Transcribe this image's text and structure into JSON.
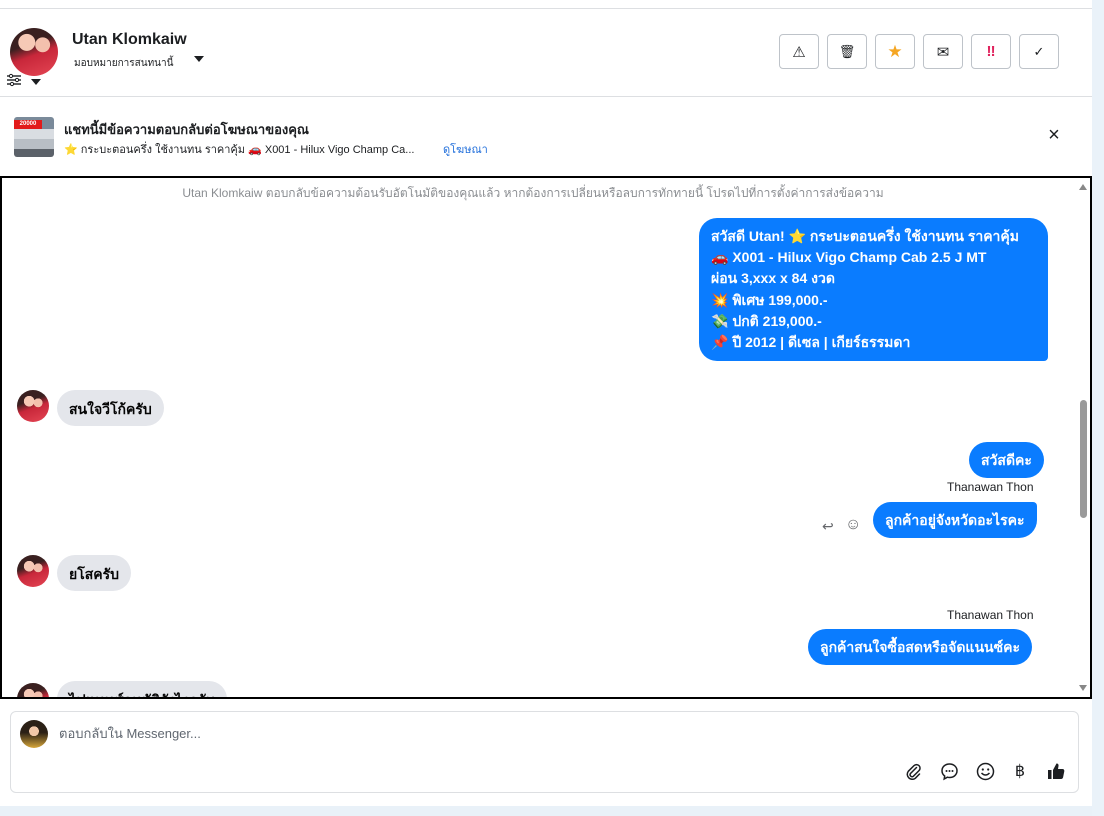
{
  "header": {
    "user_name": "Utan Klomkaiw",
    "assign_label": "มอบหมายการสนทนานี้",
    "actions": [
      {
        "name": "spam-button",
        "glyph": "⚠"
      },
      {
        "name": "delete-button",
        "glyph": "🗑"
      },
      {
        "name": "star-button",
        "glyph": "★"
      },
      {
        "name": "mark-unread-button",
        "glyph": "✉"
      },
      {
        "name": "follow-up-button",
        "glyph": "‼"
      },
      {
        "name": "done-button",
        "glyph": "✓"
      }
    ]
  },
  "ad": {
    "thumb_tag": "20000",
    "title": "แชทนี้มีข้อความตอบกลับต่อโฆษณาของคุณ",
    "description": "⭐ กระบะตอนครึ่ง ใช้งานทน ราคาคุ้ม 🚗 X001 - Hilux Vigo Champ Ca...",
    "link": "ดูโฆษณา",
    "close": "×"
  },
  "chat": {
    "system_note": "Utan Klomkaiw ตอบกลับข้อความต้อนรับอัตโนมัติของคุณแล้ว หากต้องการเปลี่ยนหรือลบการทักทายนี้ โปรดไปที่การตั้งค่าการส่งข้อความ",
    "welcome_lines": [
      "สวัสดี Utan! ⭐ กระบะตอนครึ่ง ใช้งานทน ราคาคุ้ม",
      "🚗 X001 - Hilux Vigo Champ Cab 2.5 J MT",
      "ผ่อน 3,xxx x 84 งวด",
      "💥 พิเศษ 199,000.-",
      "💸 ปกติ 219,000.-",
      "📌 ปี 2012 | ดีเซล | เกียร์ธรรมดา"
    ],
    "msg_in_1": "สนใจวีโก้ครับ",
    "msg_out_1": "สวัสดีคะ",
    "sender_1": "Thanawan Thon",
    "msg_out_2": "ลูกค้าอยู่จังหวัดอะไรคะ",
    "msg_in_2": "ยโสครับ",
    "sender_2": "Thanawan Thon",
    "msg_out_3": "ลูกค้าสนใจซื้อสดหรือจัดแนนซ์คะ",
    "msg_in_3": "ไฟแนนซ์อนุมัติยังไงครับ",
    "reply_icon": "↩",
    "react_icon": "☺"
  },
  "composer": {
    "placeholder": "ตอบกลับใน Messenger...",
    "icons": [
      {
        "name": "attach-icon",
        "glyph": "📎"
      },
      {
        "name": "saved-reply-icon",
        "glyph": "💬"
      },
      {
        "name": "emoji-icon",
        "glyph": "☺"
      },
      {
        "name": "payment-icon",
        "glyph": "฿"
      },
      {
        "name": "like-icon",
        "glyph": "👍"
      }
    ]
  },
  "colors": {
    "outgoing_bubble": "#0a7cff",
    "incoming_bubble": "#e4e6eb",
    "star": "#f5a623",
    "follow_up": "#e0245e"
  }
}
